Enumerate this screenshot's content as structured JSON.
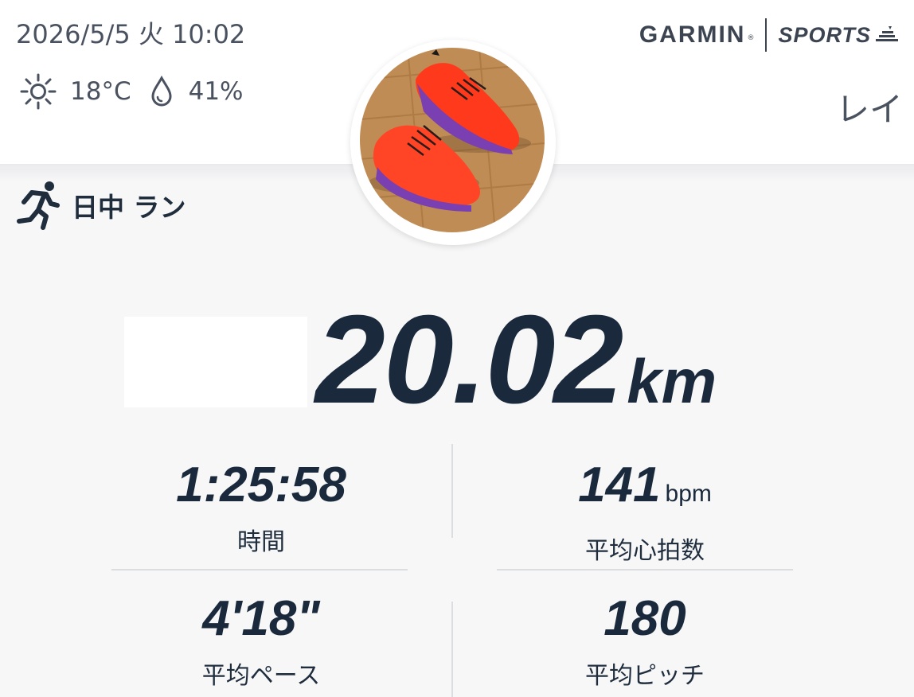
{
  "header": {
    "datetime": "2026/5/5 火 10:02",
    "weather": {
      "icon": "sun-icon",
      "temperature": "18°C",
      "humidity_icon": "water-drop-icon",
      "humidity": "41%"
    },
    "brand": {
      "garmin": "GARMIN",
      "registered": "®",
      "sports": "SPORTS"
    },
    "username": "レイ"
  },
  "activity": {
    "icon": "runner-icon",
    "type_label": "日中 ラン"
  },
  "summary": {
    "distance_value": "20.02",
    "distance_unit": "km"
  },
  "stats": {
    "time": {
      "value": "1:25:58",
      "label": "時間"
    },
    "heart_rate": {
      "value": "141",
      "unit": "bpm",
      "label": "平均心拍数"
    },
    "pace": {
      "value": "4'18\"",
      "label": "平均ペース"
    },
    "cadence": {
      "value": "180",
      "label": "平均ピッチ"
    }
  },
  "colors": {
    "accent_text": "#1a2a3c",
    "muted_text": "#4a5260",
    "background": "#f7f7f8",
    "header_background": "#ffffff",
    "divider": "#dcdde0"
  }
}
